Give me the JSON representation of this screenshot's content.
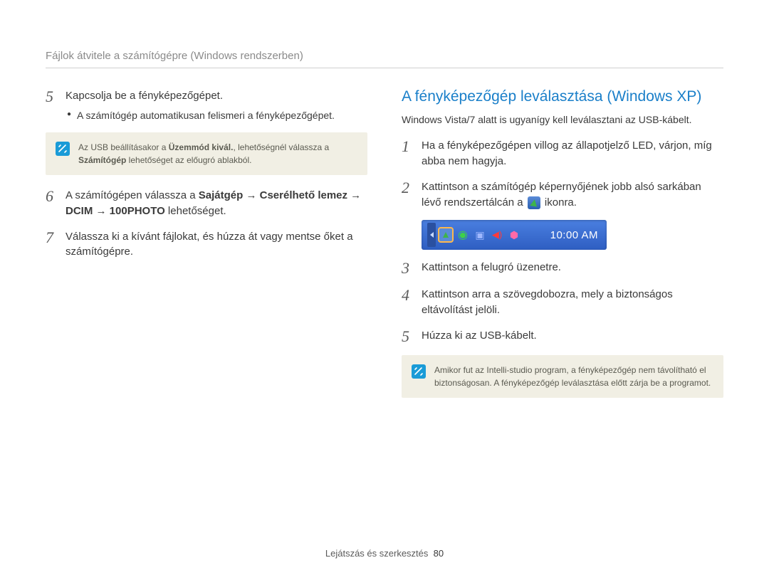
{
  "header": {
    "title": "Fájlok átvitele a számítógépre (Windows rendszerben)"
  },
  "left": {
    "step5": {
      "num": "5",
      "text": "Kapcsolja be a fényképezőgépet.",
      "bullet": "A számítógép automatikusan felismeri a fényképezőgépet."
    },
    "note1": {
      "pre": "Az USB beállításakor a ",
      "bold1": "Üzemmód kivál.",
      "mid": ", lehetőségnél válassza a ",
      "bold2": "Számítógép",
      "post": " lehetőséget az előugró ablakból."
    },
    "step6": {
      "num": "6",
      "pre": "A számítógépen válassza a ",
      "bold": "Sajátgép → Cserélhető lemez → DCIM → 100PHOTO",
      "post": " lehetőséget."
    },
    "step7": {
      "num": "7",
      "text": "Válassza ki a kívánt fájlokat, és húzza át vagy mentse őket a számítógépre."
    }
  },
  "right": {
    "title": "A fényképezőgép leválasztása (Windows XP)",
    "intro": "Windows Vista/7 alatt is ugyanígy kell leválasztani az USB-kábelt.",
    "step1": {
      "num": "1",
      "text": "Ha a fényképezőgépen villog az állapotjelző LED, várjon, míg abba nem hagyja."
    },
    "step2": {
      "num": "2",
      "pre": "Kattintson a számítógép képernyőjének jobb alsó sarkában lévő rendszertálcán a ",
      "post": " ikonra."
    },
    "taskbar": {
      "time": "10:00 AM"
    },
    "step3": {
      "num": "3",
      "text": "Kattintson a felugró üzenetre."
    },
    "step4": {
      "num": "4",
      "text": "Kattintson arra a szövegdobozra, mely a biztonságos eltávolítást jelöli."
    },
    "step5": {
      "num": "5",
      "text": "Húzza ki az USB-kábelt."
    },
    "note2": {
      "text": "Amikor fut az Intelli-studio program, a fényképezőgép nem távolítható el biztonságosan. A fényképezőgép leválasztása előtt zárja be a programot."
    }
  },
  "footer": {
    "label": "Lejátszás és szerkesztés",
    "page": "80"
  }
}
